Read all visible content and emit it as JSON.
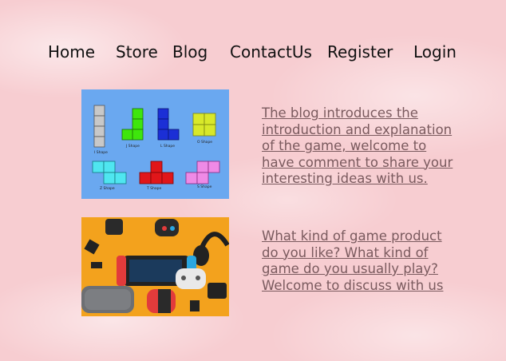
{
  "nav": {
    "home": "Home",
    "store": "Store",
    "blog": "Blog",
    "contact": "ContactUs",
    "register": "Register",
    "login": "Login"
  },
  "cards": [
    {
      "image": "tetromino-shapes-illustration",
      "text": "The blog introduces the introduction and explanation of the game, welcome to have comment to share your interesting ideas with us.",
      "shape_labels": [
        "I Shape",
        "J Shape",
        "L Shape",
        "O Shape",
        "Z Shape",
        "T Shape",
        "S Shape"
      ]
    },
    {
      "image": "game-controllers-photo",
      "text": "What kind of game product do you like? What kind of game do you usually play? Welcome to discuss with us"
    }
  ],
  "colors": {
    "background": "#f7cdd1",
    "link_text": "#7a5a5e",
    "tetromino_bg": "#6aa8f0",
    "controllers_bg": "#f3a21d"
  }
}
